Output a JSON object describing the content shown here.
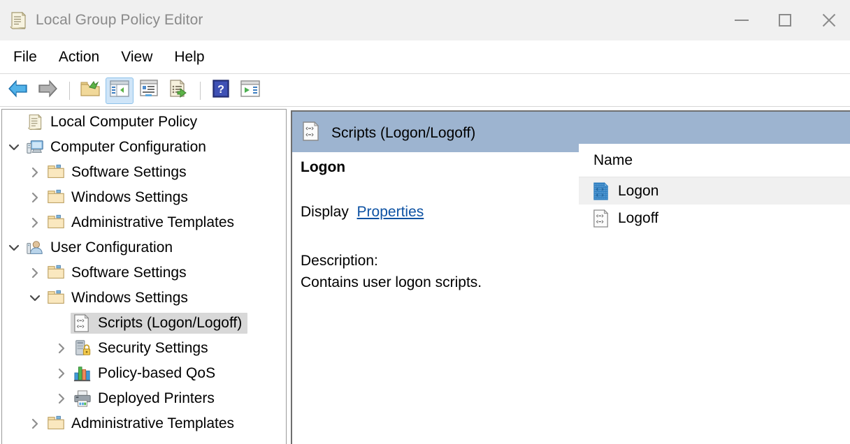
{
  "window": {
    "title": "Local Group Policy Editor",
    "icon": "policy-scroll-icon",
    "controls": {
      "minimize": "Minimize",
      "maximize": "Maximize",
      "close": "Close"
    }
  },
  "menu": {
    "items": [
      {
        "label": "File",
        "name": "menu-file"
      },
      {
        "label": "Action",
        "name": "menu-action"
      },
      {
        "label": "View",
        "name": "menu-view"
      },
      {
        "label": "Help",
        "name": "menu-help"
      }
    ]
  },
  "toolbar": {
    "buttons": [
      {
        "name": "back-button",
        "icon": "back-arrow-icon",
        "pressed": false
      },
      {
        "name": "forward-button",
        "icon": "forward-arrow-icon",
        "pressed": false
      },
      {
        "name": "up-one-level-button",
        "icon": "folder-up-icon",
        "pressed": false
      },
      {
        "name": "show-hide-console-tree-button",
        "icon": "console-tree-icon",
        "pressed": true
      },
      {
        "name": "properties-button",
        "icon": "properties-window-icon",
        "pressed": false
      },
      {
        "name": "export-list-button",
        "icon": "export-list-icon",
        "pressed": false
      },
      {
        "name": "help-button",
        "icon": "help-question-icon",
        "pressed": false
      },
      {
        "name": "show-hide-action-pane-button",
        "icon": "action-pane-icon",
        "pressed": false
      }
    ]
  },
  "tree": {
    "nodes": [
      {
        "label": "Local Computer Policy",
        "icon": "policy-scroll-icon",
        "indent": 0,
        "expander": "none",
        "selected": false
      },
      {
        "label": "Computer Configuration",
        "icon": "computer-icon",
        "indent": 0,
        "expander": "expanded",
        "selected": false
      },
      {
        "label": "Software Settings",
        "icon": "folder-icon",
        "indent": 1,
        "expander": "collapsed",
        "selected": false
      },
      {
        "label": "Windows Settings",
        "icon": "folder-icon",
        "indent": 1,
        "expander": "collapsed",
        "selected": false
      },
      {
        "label": "Administrative Templates",
        "icon": "folder-icon",
        "indent": 1,
        "expander": "collapsed",
        "selected": false
      },
      {
        "label": "User Configuration",
        "icon": "user-icon",
        "indent": 0,
        "expander": "expanded",
        "selected": false
      },
      {
        "label": "Software Settings",
        "icon": "folder-icon",
        "indent": 1,
        "expander": "collapsed",
        "selected": false
      },
      {
        "label": "Windows Settings",
        "icon": "folder-icon",
        "indent": 1,
        "expander": "expanded",
        "selected": false
      },
      {
        "label": "Scripts (Logon/Logoff)",
        "icon": "scripts-icon",
        "indent": 2,
        "expander": "none",
        "selected": true
      },
      {
        "label": "Security Settings",
        "icon": "security-lock-icon",
        "indent": 2,
        "expander": "collapsed",
        "selected": false
      },
      {
        "label": "Policy-based QoS",
        "icon": "bar-chart-icon",
        "indent": 2,
        "expander": "collapsed",
        "selected": false
      },
      {
        "label": "Deployed Printers",
        "icon": "printer-icon",
        "indent": 2,
        "expander": "collapsed",
        "selected": false
      },
      {
        "label": "Administrative Templates",
        "icon": "folder-icon",
        "indent": 1,
        "expander": "collapsed",
        "selected": false
      }
    ]
  },
  "content": {
    "header_title": "Scripts (Logon/Logoff)",
    "header_icon": "scripts-icon",
    "selected_item": "Logon",
    "display_label": "Display",
    "properties_link": "Properties",
    "description_label": "Description:",
    "description_text": "Contains user logon scripts."
  },
  "list": {
    "columns": [
      "Name"
    ],
    "rows": [
      {
        "name": "Logon",
        "icon": "script-selected-icon",
        "selected": true
      },
      {
        "name": "Logoff",
        "icon": "scripts-icon",
        "selected": false
      }
    ]
  },
  "colors": {
    "header_band": "#9db4d0",
    "tree_selection": "#d8d8d8",
    "list_selection": "#f0f0f0",
    "link": "#0d52a3",
    "toolbar_pressed": "#cfe5f8"
  }
}
